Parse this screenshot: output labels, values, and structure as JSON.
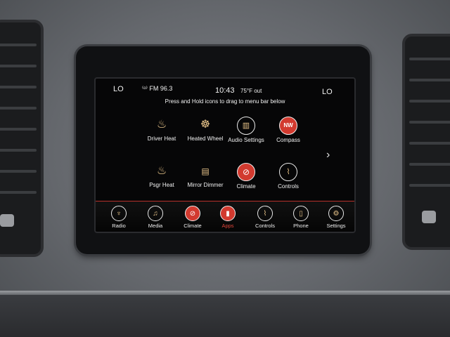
{
  "status": {
    "left_lo": "LO",
    "radio": "FM 96.3",
    "time": "10:43",
    "outside_temp": "75°F out",
    "right_lo": "LO"
  },
  "hint": "Press and Hold icons to drag to menu bar below",
  "apps": [
    {
      "label": "Driver Heat",
      "icon": "driver-seat-heat-icon"
    },
    {
      "label": "Heated Wheel",
      "icon": "heated-wheel-icon"
    },
    {
      "label": "Audio Settings",
      "icon": "audio-settings-icon"
    },
    {
      "label": "Compass",
      "icon": "compass-icon",
      "glyph": "NW"
    },
    {
      "label": "Psgr Heat",
      "icon": "passenger-seat-heat-icon"
    },
    {
      "label": "Mirror Dimmer",
      "icon": "mirror-dimmer-icon"
    },
    {
      "label": "Climate",
      "icon": "climate-icon"
    },
    {
      "label": "Controls",
      "icon": "controls-icon"
    }
  ],
  "menu_bar": [
    {
      "label": "Radio",
      "icon": "radio-icon"
    },
    {
      "label": "Media",
      "icon": "media-icon"
    },
    {
      "label": "Climate",
      "icon": "climate-icon"
    },
    {
      "label": "Apps",
      "icon": "apps-icon",
      "active": true
    },
    {
      "label": "Controls",
      "icon": "controls-icon"
    },
    {
      "label": "Phone",
      "icon": "phone-icon"
    },
    {
      "label": "Settings",
      "icon": "settings-icon"
    }
  ],
  "colors": {
    "accent_red": "#d23a2f",
    "icon_tan": "#e8c48a"
  }
}
